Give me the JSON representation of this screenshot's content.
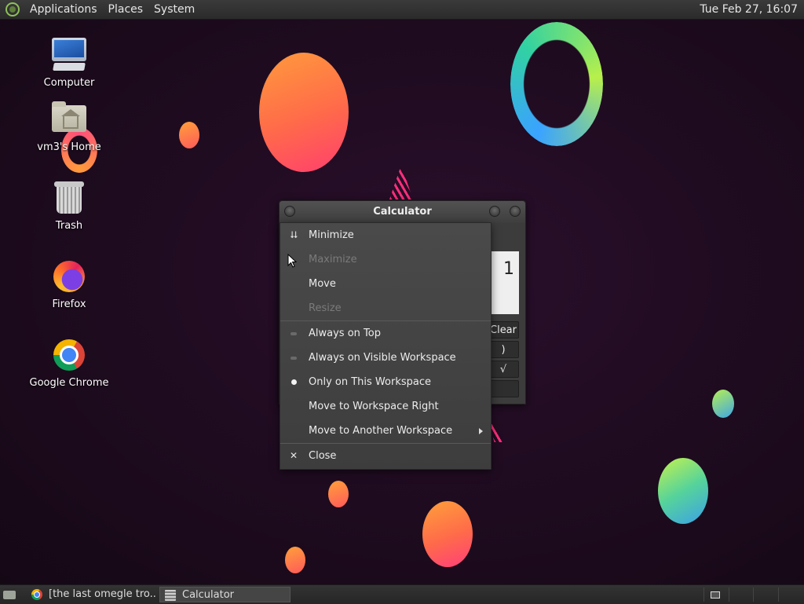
{
  "top_panel": {
    "menus": [
      "Applications",
      "Places",
      "System"
    ],
    "clock": "Tue Feb 27, 16:07"
  },
  "desktop_icons": [
    {
      "label": "Computer",
      "icon": "computer-icon"
    },
    {
      "label": "vm3's Home",
      "icon": "home-folder-icon"
    },
    {
      "label": "Trash",
      "icon": "trash-icon"
    },
    {
      "label": "Firefox",
      "icon": "firefox-icon"
    },
    {
      "label": "Google Chrome",
      "icon": "chrome-icon"
    }
  ],
  "calculator": {
    "title": "Calculator",
    "display": "1",
    "keys": [
      "Clear",
      ")",
      "√",
      ""
    ]
  },
  "window_menu": {
    "minimize": "Minimize",
    "maximize": "Maximize",
    "move": "Move",
    "resize": "Resize",
    "always_on_top": "Always on Top",
    "always_visible": "Always on Visible Workspace",
    "only_this_ws": "Only on This Workspace",
    "move_ws_right": "Move to Workspace Right",
    "move_another_ws": "Move to Another Workspace",
    "close": "Close",
    "disabled_items": [
      "Maximize",
      "Resize"
    ],
    "selected_radio": "Only on This Workspace"
  },
  "taskbar": {
    "tasks": [
      {
        "label": "[the last omegle tro...",
        "icon": "chrome-icon"
      },
      {
        "label": "Calculator",
        "icon": "calculator-icon",
        "active": true
      }
    ],
    "workspaces": 4,
    "active_workspace": 1
  }
}
